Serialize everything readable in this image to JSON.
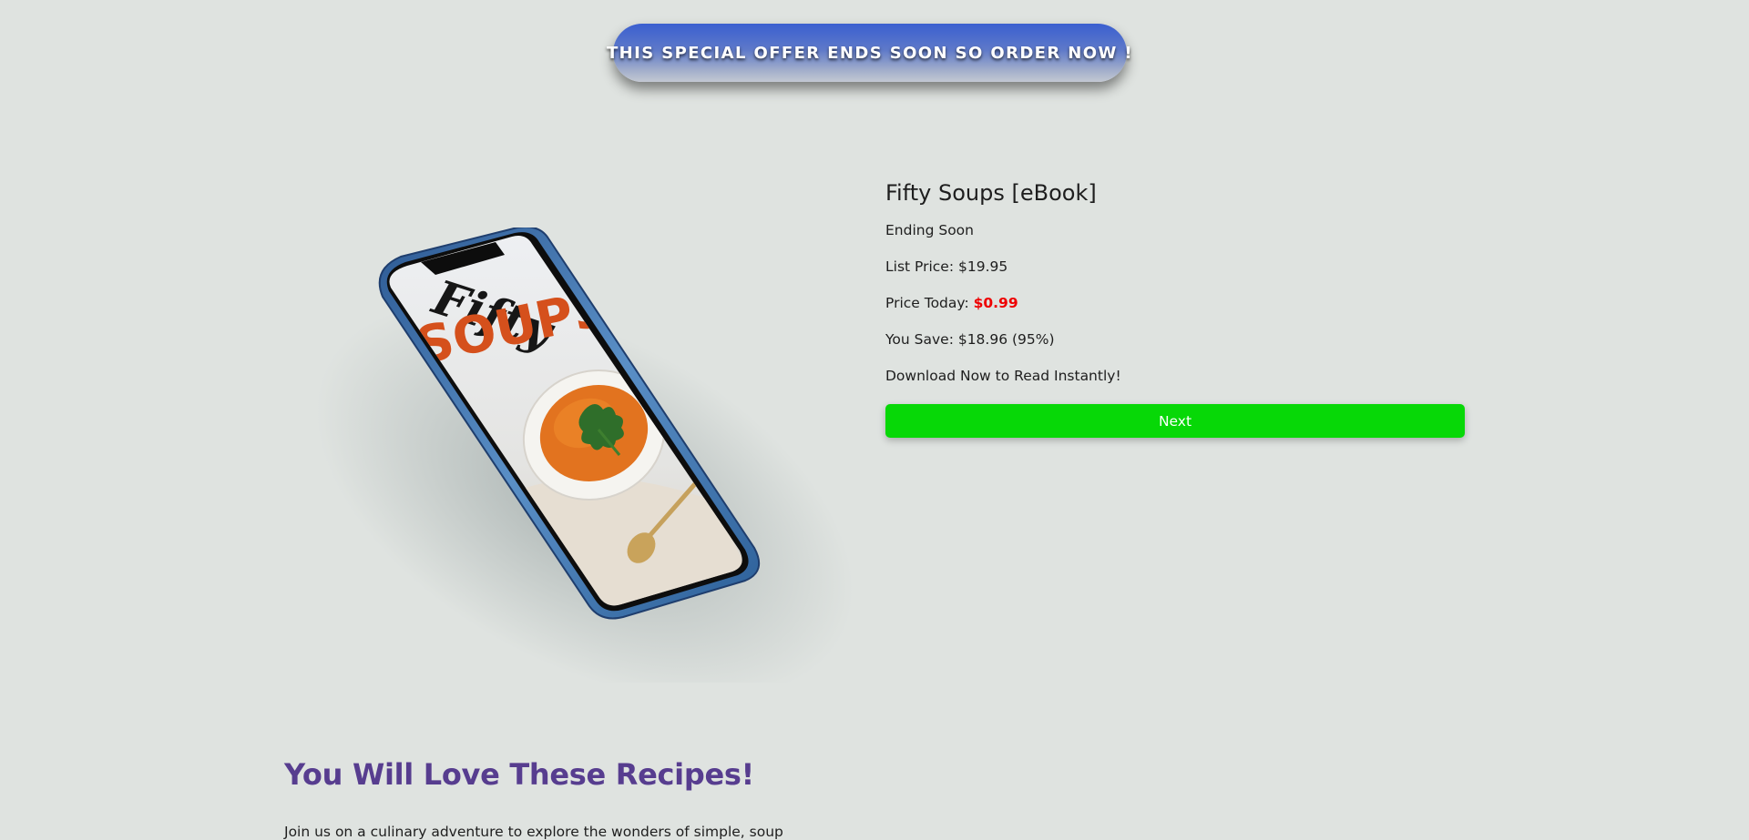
{
  "banner": {
    "text": "THIS SPECIAL OFFER ENDS SOON SO ORDER NOW !"
  },
  "product": {
    "image_icon": "ebook-phone-mockup",
    "cover_line_1": "Fifty",
    "cover_line_2": "SOUPS",
    "title": "Fifty Soups [eBook]",
    "status": "Ending Soon",
    "list_price": "List Price: $19.95",
    "price_today_label": "Price Today: ",
    "price_today_value": "$0.99",
    "you_save": "You Save: $18.96 (95%)",
    "download_text": "Download Now to Read Instantly!",
    "next_label": "Next"
  },
  "section": {
    "heading": "You Will Love These Recipes!",
    "intro": "Join us on a culinary adventure to explore the wonders of simple, soup"
  },
  "colors": {
    "background": "#dfe3e0",
    "banner_top": "#3a5fd0",
    "price_red": "#ee0000",
    "next_green": "#07d807",
    "heading_purple": "#573d8f"
  }
}
